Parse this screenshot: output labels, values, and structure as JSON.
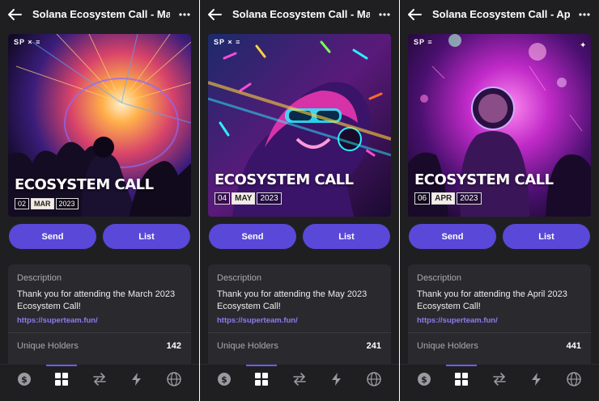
{
  "panels": [
    {
      "title": "Solana Ecosystem Call - Marc...",
      "art": {
        "brand_mark": "SP × ≡",
        "heading": "ECOSYSTEM CALL",
        "day": "02",
        "month": "MAR",
        "year": "2023",
        "palette": [
          "#1a0d3a",
          "#ff7a2a",
          "#2a8bff"
        ]
      },
      "send_label": "Send",
      "list_label": "List",
      "description_label": "Description",
      "description_text": "Thank you for attending the March 2023 Ecosystem Call!",
      "link": "https://superteam.fun/",
      "holders_label": "Unique Holders",
      "holders_value": "142"
    },
    {
      "title": "Solana Ecosystem Call - May...",
      "art": {
        "brand_mark": "SP × ≡",
        "heading": "ECOSYSTEM CALL",
        "day": "04",
        "month": "MAY",
        "year": "2023",
        "palette": [
          "#2a0f4a",
          "#ff3ac8",
          "#2af0ff"
        ]
      },
      "send_label": "Send",
      "list_label": "List",
      "description_label": "Description",
      "description_text": "Thank you for attending the May 2023 Ecosystem Call!",
      "link": "https://superteam.fun/",
      "holders_label": "Unique Holders",
      "holders_value": "241"
    },
    {
      "title": "Solana Ecosystem Call - April...",
      "art": {
        "brand_mark": "SP ≡",
        "heading": "ECOSYSTEM CALL",
        "day": "06",
        "month": "APR",
        "year": "2023",
        "palette": [
          "#240a3a",
          "#e03ad8",
          "#7a2ae0"
        ]
      },
      "send_label": "Send",
      "list_label": "List",
      "description_label": "Description",
      "description_text": "Thank you for attending the April 2023 Ecosystem Call!",
      "link": "https://superteam.fun/",
      "holders_label": "Unique Holders",
      "holders_value": "441"
    }
  ],
  "tabbar": {
    "icons": [
      "dollar-icon",
      "grid-icon",
      "swap-icon",
      "lightning-icon",
      "globe-icon"
    ],
    "active": "grid-icon"
  },
  "colors": {
    "accent": "#5a48d8",
    "link": "#8c7df0",
    "panel_bg": "#1f1f22",
    "card_bg": "#2a2a2e"
  }
}
